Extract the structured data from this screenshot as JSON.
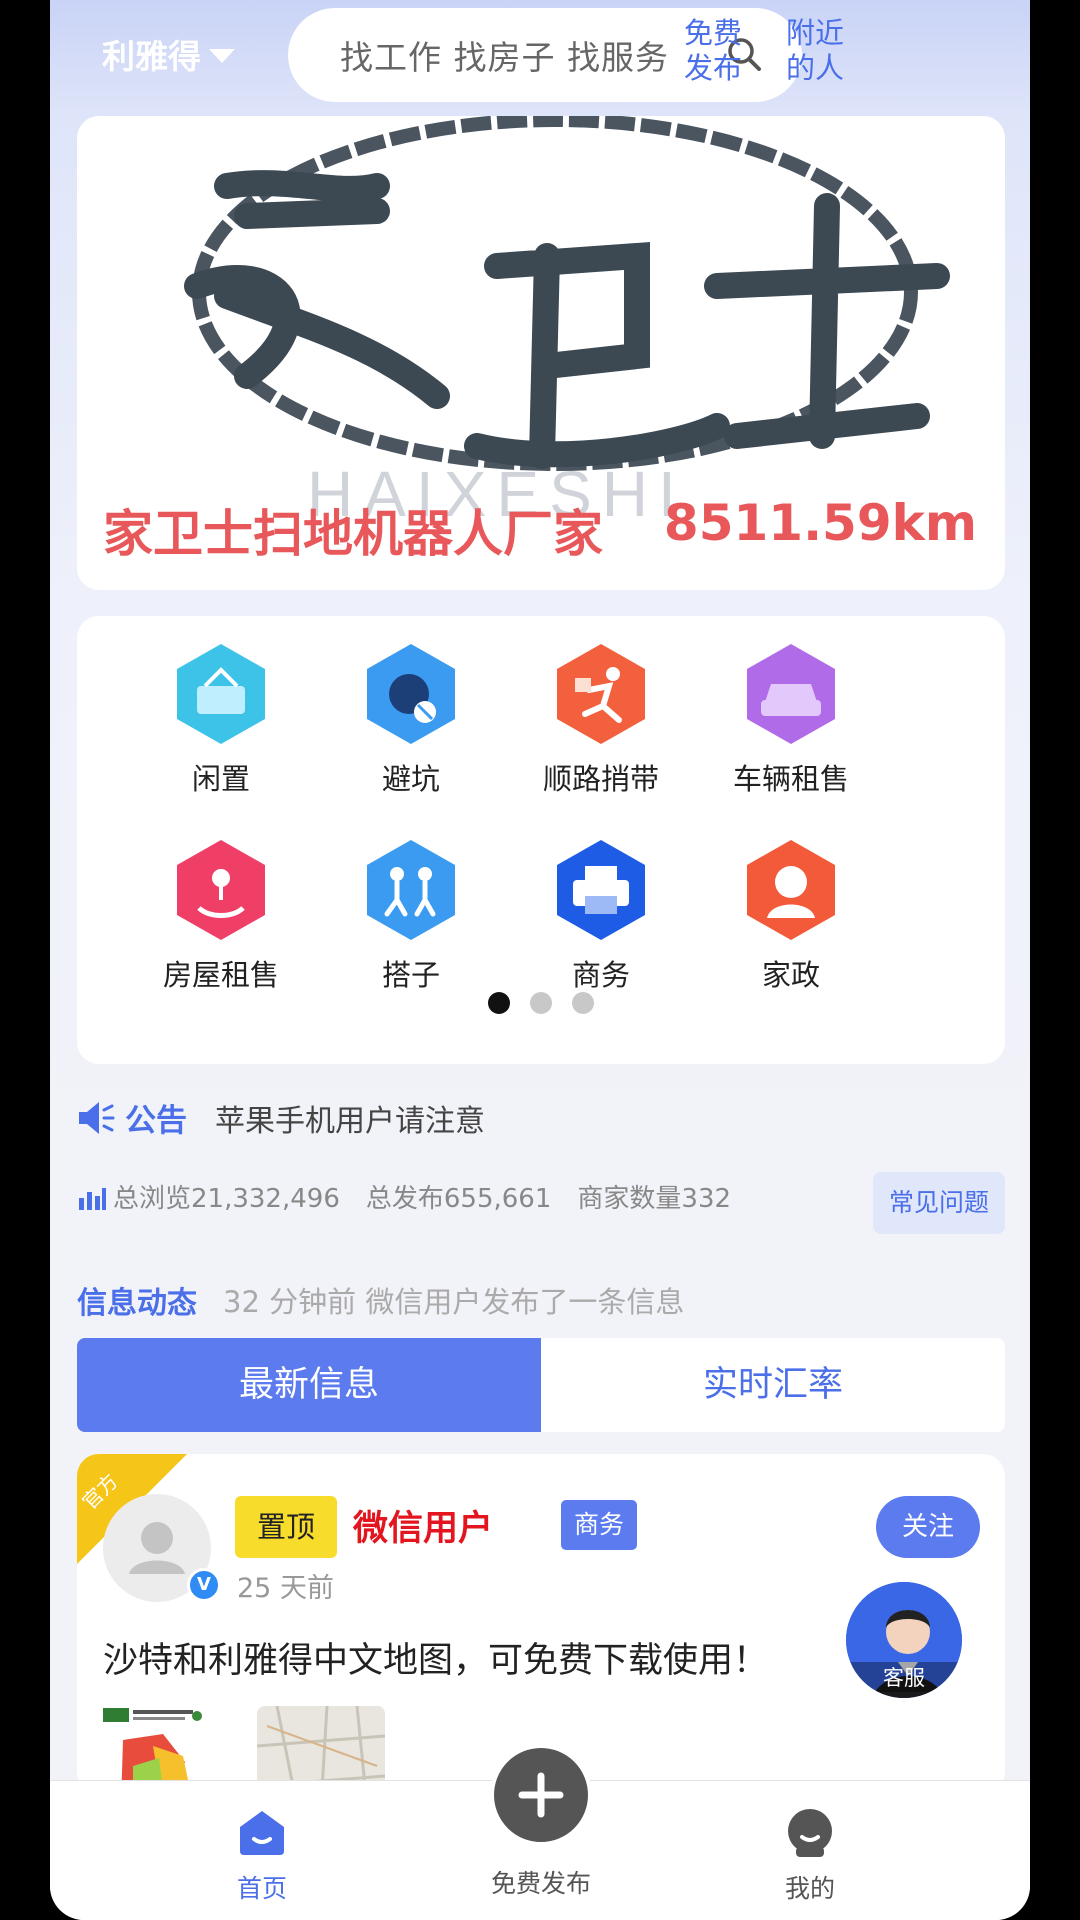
{
  "header": {
    "city": "利雅得",
    "search_placeholder": "找工作 找房子 找服务",
    "free_post": [
      "免费",
      "发布"
    ],
    "nearby": [
      "附近",
      "的人"
    ]
  },
  "banner": {
    "title": "家卫士扫地机器人厂家",
    "distance": "8511.59km"
  },
  "categories": [
    {
      "label": "闲置",
      "icon": "idle-goods-icon",
      "color": "#3ec3e8"
    },
    {
      "label": "避坑",
      "icon": "avoid-trap-icon",
      "color": "#3a9bf0"
    },
    {
      "label": "顺路捎带",
      "icon": "errand-icon",
      "color": "#f2603e"
    },
    {
      "label": "车辆租售",
      "icon": "car-icon",
      "color": "#b06be8"
    },
    {
      "label": "房屋租售",
      "icon": "house-icon",
      "color": "#ef3f67"
    },
    {
      "label": "搭子",
      "icon": "partner-icon",
      "color": "#3a9bf0"
    },
    {
      "label": "商务",
      "icon": "printer-icon",
      "color": "#1e5ce6"
    },
    {
      "label": "家政",
      "icon": "housekeeping-icon",
      "color": "#f25a3a"
    }
  ],
  "pager": {
    "count": 3,
    "active": 0
  },
  "notice": {
    "tag": "公告",
    "text": "苹果手机用户请注意"
  },
  "stats": {
    "views": "总浏览21,332,496",
    "posts": "总发布655,661",
    "merchants": "商家数量332",
    "faq": "常见问题"
  },
  "feed": {
    "title": "信息动态",
    "latest": "32 分钟前 微信用户发布了一条信息"
  },
  "tabs": [
    {
      "label": "最新信息",
      "active": true
    },
    {
      "label": "实时汇率",
      "active": false
    }
  ],
  "post": {
    "ribbon": "官方",
    "pin": "置顶",
    "user": "微信用户",
    "category": "商务",
    "time": "25 天前",
    "follow": "关注",
    "text": "沙特和利雅得中文地图，可免费下载使用！"
  },
  "service": {
    "label": "客服"
  },
  "bottom_nav": {
    "home": "首页",
    "post": "免费发布",
    "mine": "我的"
  }
}
